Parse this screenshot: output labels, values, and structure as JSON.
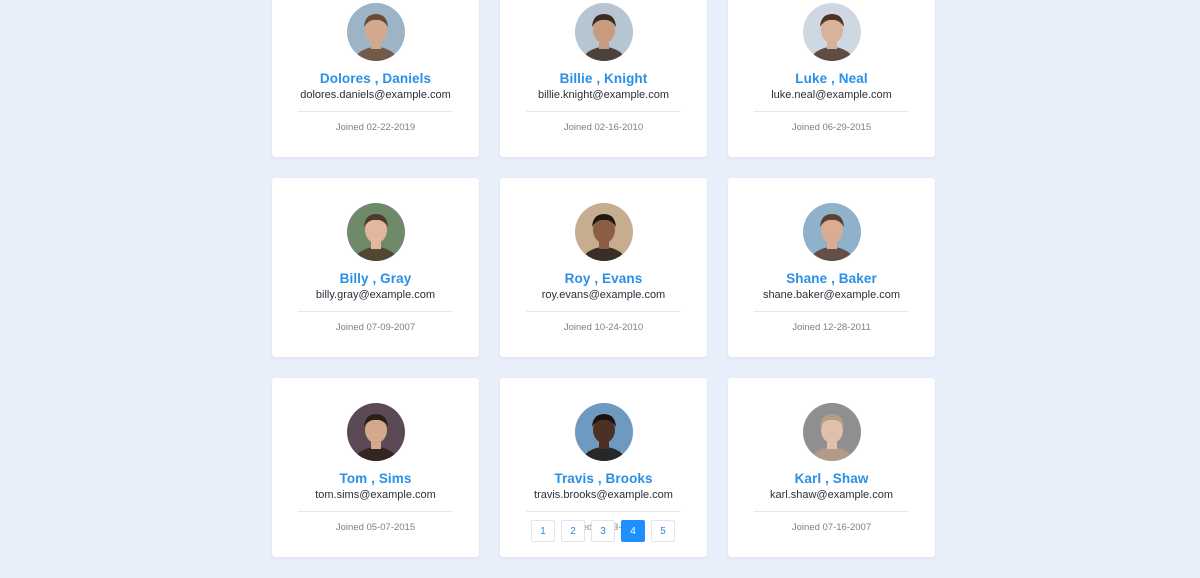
{
  "users": [
    {
      "name": "Dolores , Daniels",
      "email": "dolores.daniels@example.com",
      "joined": "Joined 02-22-2019",
      "skin": "#d2a98e",
      "hair": "#6b4a35",
      "bg": "#9db4c6"
    },
    {
      "name": "Billie , Knight",
      "email": "billie.knight@example.com",
      "joined": "Joined 02-16-2010",
      "skin": "#c99b7e",
      "hair": "#3a2a22",
      "bg": "#b7c4d1"
    },
    {
      "name": "Luke , Neal",
      "email": "luke.neal@example.com",
      "joined": "Joined 06-29-2015",
      "skin": "#d9b29a",
      "hair": "#4a3528",
      "bg": "#cfd8e2"
    },
    {
      "name": "Billy , Gray",
      "email": "billy.gray@example.com",
      "joined": "Joined 07-09-2007",
      "skin": "#e1b79d",
      "hair": "#4d3a2c",
      "bg": "#6f8a6a"
    },
    {
      "name": "Roy , Evans",
      "email": "roy.evans@example.com",
      "joined": "Joined 10-24-2010",
      "skin": "#8b5e43",
      "hair": "#1f1713",
      "bg": "#c7ad8f"
    },
    {
      "name": "Shane , Baker",
      "email": "shane.baker@example.com",
      "joined": "Joined 12-28-2011",
      "skin": "#d8ad94",
      "hair": "#5a4030",
      "bg": "#8fb1c9"
    },
    {
      "name": "Tom , Sims",
      "email": "tom.sims@example.com",
      "joined": "Joined 05-07-2015",
      "skin": "#d4a88c",
      "hair": "#2b1f1a",
      "bg": "#5b4a55"
    },
    {
      "name": "Travis , Brooks",
      "email": "travis.brooks@example.com",
      "joined": "Joined 11-23-2008",
      "skin": "#4b3023",
      "hair": "#1b120e",
      "bg": "#6e9ac0"
    },
    {
      "name": "Karl , Shaw",
      "email": "karl.shaw@example.com",
      "joined": "Joined 07-16-2007",
      "skin": "#e1c0ab",
      "hair": "#b89c86",
      "bg": "#8d8f91"
    }
  ],
  "pagination": {
    "pages": [
      "1",
      "2",
      "3",
      "4",
      "5"
    ],
    "current": "4"
  },
  "colors": {
    "accent": "#2a8fe6",
    "active_page": "#1e8fff",
    "background": "#e8eefa"
  }
}
